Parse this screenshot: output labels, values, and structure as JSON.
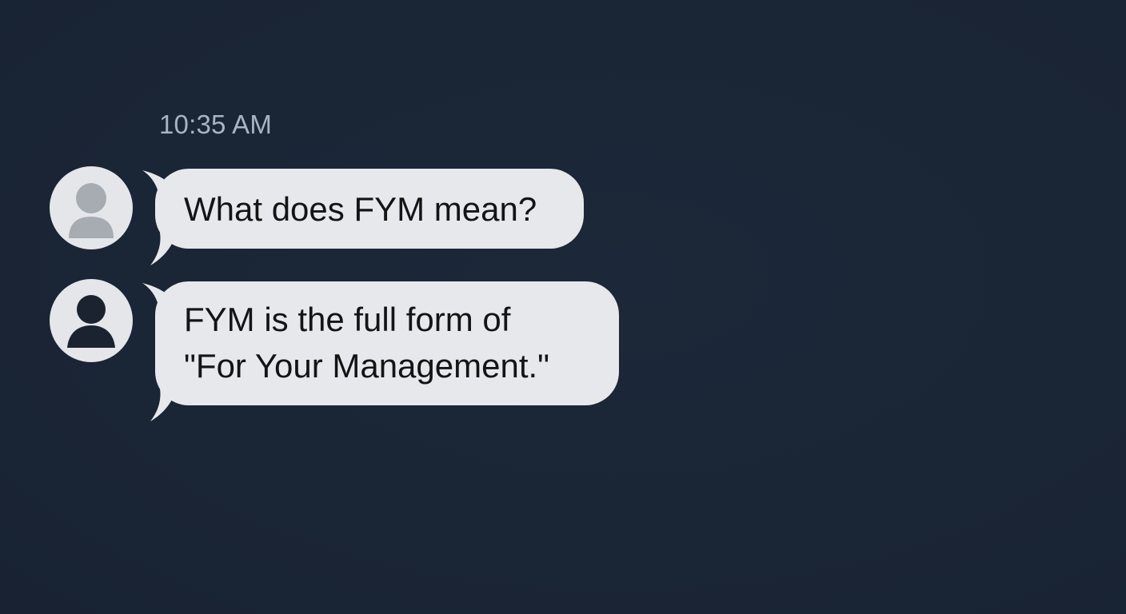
{
  "conversation": {
    "timestamp": "10:35 AM",
    "messages": [
      {
        "lines": [
          "What does FYM mean?"
        ],
        "avatar_icon": "user-avatar-icon-grey"
      },
      {
        "lines": [
          "FYM is the full form of",
          "\"For Your Management.\""
        ],
        "avatar_icon": "user-avatar-icon-dark"
      }
    ]
  },
  "colors": {
    "background": "#1b2637",
    "bubble": "#e6e8ec",
    "timestamp": "#aab3c0",
    "text": "#141414",
    "avatar_bg": "#e4e6ea",
    "avatar_glyph_grey": "#a7abb2",
    "avatar_glyph_dark": "#1b2330"
  }
}
